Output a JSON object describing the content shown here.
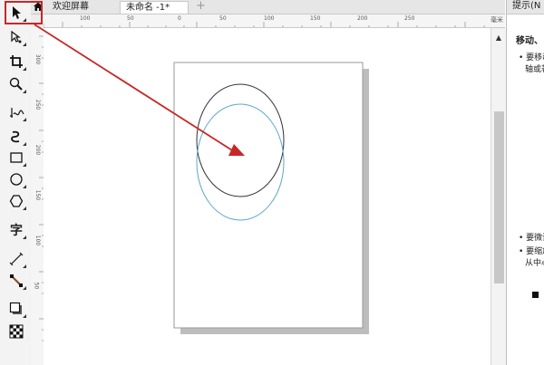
{
  "tabs": {
    "home_label": "",
    "welcome": "欢迎屏幕",
    "document": "未命名 -1*",
    "add": "+"
  },
  "ruler": {
    "h_ticks": [
      "100",
      "50",
      "0",
      "50",
      "100",
      "150",
      "200",
      "250"
    ],
    "v_ticks": [
      "300",
      "250",
      "200",
      "150",
      "100",
      "50"
    ],
    "unit": "毫米"
  },
  "hints": {
    "title": "提示(N",
    "heading": "移动、",
    "line1": "• 要移动",
    "line2": "轴或著",
    "line3": "• 要微调",
    "line4": "• 要缩放",
    "line5": "从中心"
  },
  "scroll": {
    "up": "▲"
  },
  "colors": {
    "highlight": "#c62828",
    "ellipse_black": "#333333",
    "ellipse_blue": "#5ba8c8",
    "page_shadow": "#bdbdbd"
  },
  "tools": [
    "pick-tool-icon",
    "shape-tool-icon",
    "crop-tool-icon",
    "zoom-tool-icon",
    "freehand-tool-icon",
    "artistic-media-icon",
    "rectangle-tool-icon",
    "ellipse-tool-icon",
    "polygon-tool-icon",
    "text-tool-icon",
    "dimension-tool-icon",
    "connector-tool-icon",
    "drop-shadow-tool-icon",
    "transparency-tool-icon"
  ],
  "tool_text": {
    "text": "字"
  }
}
